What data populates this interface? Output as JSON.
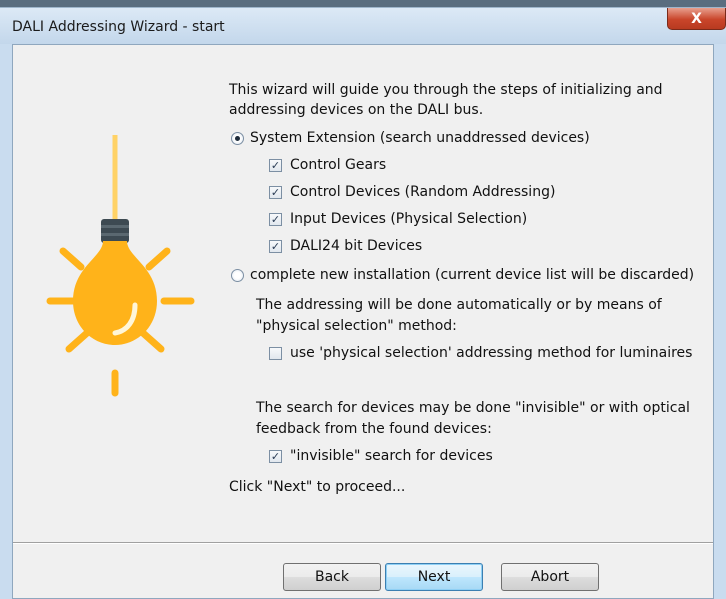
{
  "window": {
    "title": "DALI Addressing Wizard - start",
    "close_glyph": "X"
  },
  "intro": {
    "line1": "This wizard will guide you through the steps of initializing and",
    "line2": "addressing devices on the DALI bus."
  },
  "options": {
    "system_extension": {
      "label": "System Extension (search unaddressed devices)",
      "selected": true,
      "checkboxes": [
        {
          "label": "Control Gears",
          "checked": true
        },
        {
          "label": "Control Devices (Random Addressing)",
          "checked": true
        },
        {
          "label": "Input Devices (Physical Selection)",
          "checked": true
        },
        {
          "label": "DALI24 bit Devices",
          "checked": true
        }
      ]
    },
    "new_installation": {
      "label": "complete new installation (current device list will be discarded)",
      "selected": false
    }
  },
  "addressing": {
    "desc_line1": "The addressing will be done automatically or by means of",
    "desc_line2": "\"physical selection\" method:",
    "physical_selection_label": "use 'physical selection' addressing method for luminaires",
    "physical_selection_checked": false
  },
  "search": {
    "desc_line1": "The search for devices may be done \"invisible\" or with optical",
    "desc_line2": "feedback from the found devices:",
    "invisible_label": "\"invisible\" search for devices",
    "invisible_checked": true
  },
  "proceed_text": "Click \"Next\" to proceed...",
  "buttons": {
    "back": "Back",
    "next": "Next",
    "abort": "Abort"
  },
  "icons": {
    "illustration": "lightbulb-icon",
    "checkmark_glyph": "✓"
  },
  "colors": {
    "bulb": "#ffb31a",
    "bulb_light": "#ffd266",
    "bulb_base": "#3d4a52"
  }
}
